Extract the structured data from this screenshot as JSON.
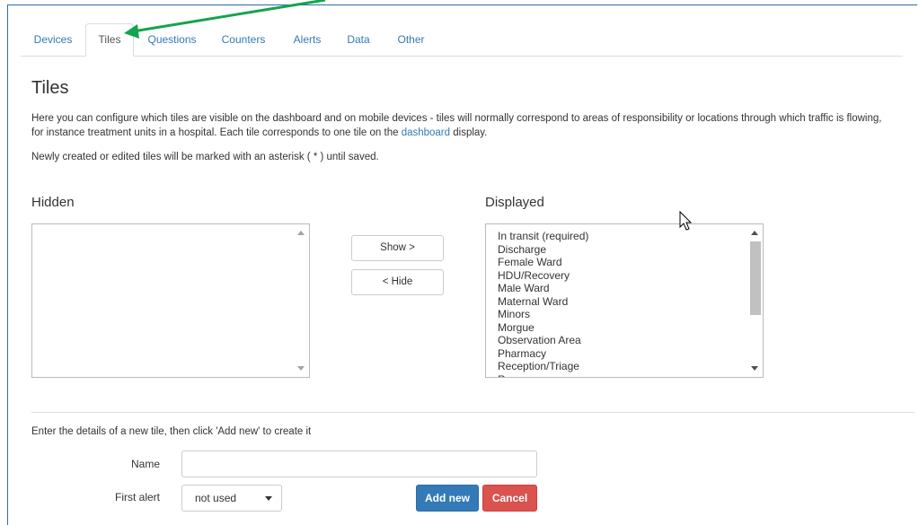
{
  "tabs": [
    {
      "label": "Devices"
    },
    {
      "label": "Tiles"
    },
    {
      "label": "Questions"
    },
    {
      "label": "Counters"
    },
    {
      "label": "Alerts"
    },
    {
      "label": "Data"
    },
    {
      "label": "Other"
    }
  ],
  "active_tab": "Tiles",
  "page": {
    "title": "Tiles",
    "intro_part1": "Here you can configure which tiles are visible on the dashboard and on mobile devices - tiles will normally correspond to areas of responsibility or locations through which traffic is flowing, for instance treatment units in a hospital. Each tile corresponds to one tile on the ",
    "intro_link": "dashboard",
    "intro_part2": " display.",
    "note": "Newly created or edited tiles will be marked with an asterisk ( * ) until saved."
  },
  "hidden_list": {
    "label": "Hidden",
    "items": []
  },
  "displayed_list": {
    "label": "Displayed",
    "items": [
      "In transit (required)",
      "Discharge",
      "Female Ward",
      "HDU/Recovery",
      "Male Ward",
      "Maternal Ward",
      "Minors",
      "Morgue",
      "Observation Area",
      "Pharmacy",
      "Reception/Triage",
      "R"
    ]
  },
  "buttons": {
    "show": "Show >",
    "hide": "< Hide",
    "add_new": "Add new",
    "cancel": "Cancel"
  },
  "new_tile": {
    "instructions": "Enter the details of a new tile, then click 'Add new' to create it",
    "name_label": "Name",
    "name_value": "",
    "first_alert_label": "First alert",
    "first_alert_value": "not used"
  },
  "colors": {
    "link": "#337ab7",
    "primary": "#337ab7",
    "danger": "#d9534f",
    "annotation_arrow": "#14a44d"
  },
  "icons": {
    "annotation": "arrow-icon",
    "cursor": "mouse-pointer-icon"
  }
}
